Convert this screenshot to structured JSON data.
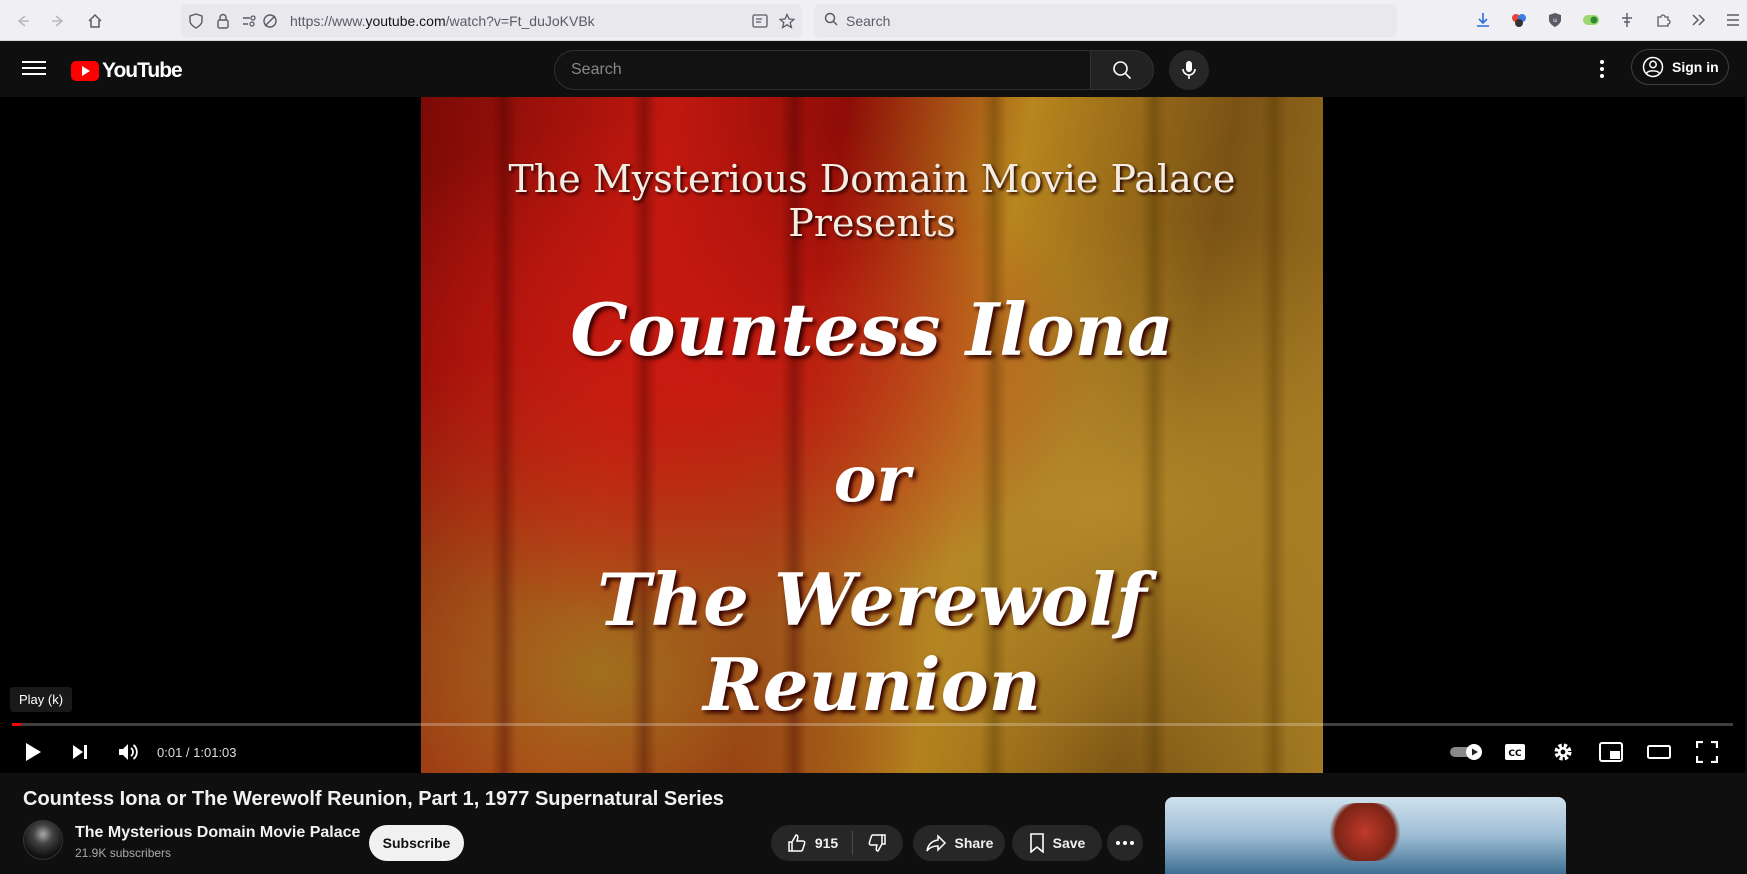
{
  "browser": {
    "url_prefix": "https://www.",
    "url_domain": "youtube.com",
    "url_path": "/watch?v=Ft_duJoKVBk",
    "search_placeholder": "Search"
  },
  "header": {
    "logo_text": "YouTube",
    "search_placeholder": "Search",
    "signin_label": "Sign in"
  },
  "player": {
    "overlay": {
      "line1": "The Mysterious Domain Movie Palace Presents",
      "line2": "Countess Ilona",
      "line3": "or",
      "line4": "The Werewolf Reunion"
    },
    "tooltip": "Play (k)",
    "time": "0:01 / 1:01:03",
    "progress": 0.0003
  },
  "video": {
    "title": "Countess Iona or The Werewolf Reunion, Part 1, 1977 Supernatural Series",
    "channel_name": "The Mysterious Domain Movie Palace",
    "subscribers": "21.9K subscribers",
    "subscribe_label": "Subscribe",
    "likes": "915",
    "share_label": "Share",
    "save_label": "Save"
  },
  "colors": {
    "brand_red": "#ff0000",
    "background": "#0f0f0f"
  }
}
